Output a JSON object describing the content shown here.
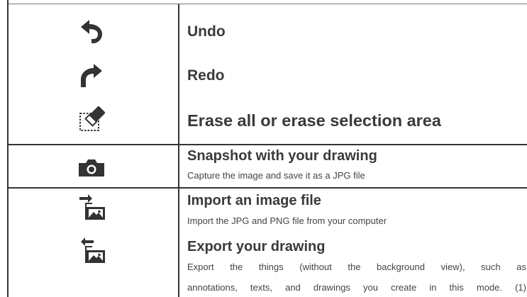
{
  "rows": [
    {
      "icon": "undo-arrow-icon",
      "title": "Undo"
    },
    {
      "icon": "redo-arrow-icon",
      "title": "Redo"
    },
    {
      "icon": "erase-selection-icon",
      "title": "Erase all or erase selection area"
    },
    {
      "icon": "camera-icon",
      "title": "Snapshot with your drawing",
      "description": "Capture the image and save it as a JPG file"
    },
    {
      "icon": "import-image-icon",
      "title": "Import an image file",
      "description": "Import the JPG and PNG file from your computer"
    },
    {
      "icon": "export-image-icon",
      "title": "Export your drawing",
      "description_lines": [
        "Export the things (without the background view), such as",
        "annotations, texts, and drawings you create in this mode. (1)"
      ]
    }
  ],
  "colors": {
    "text": "#3a3a3a",
    "icon": "#333333",
    "rule": "#333333"
  }
}
